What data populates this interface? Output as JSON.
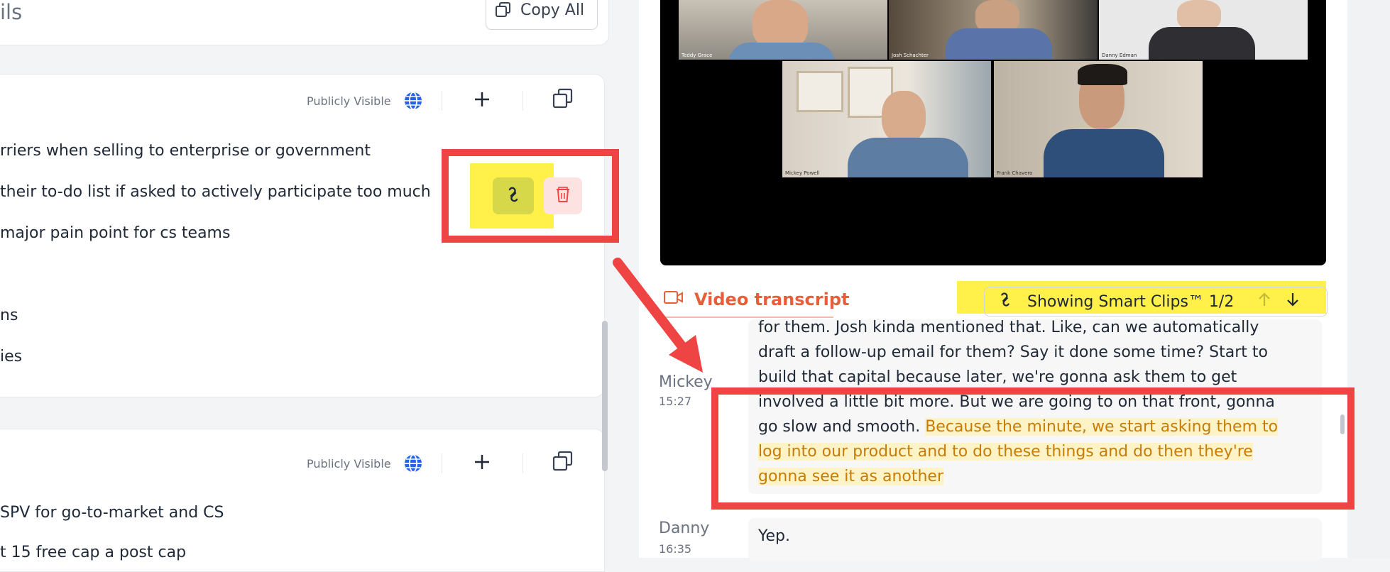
{
  "left": {
    "heading": "ils",
    "copy_all_label": "Copy All",
    "card1": {
      "visibility_label": "Publicly Visible",
      "items": [
        "rriers when selling to enterprise or government",
        "their to-do list if asked to actively participate too much",
        "major pain point for cs teams",
        "ns",
        "ies"
      ]
    },
    "card2": {
      "visibility_label": "Publicly Visible",
      "items": [
        "SPV for go-to-market and CS",
        "t 15 free cap a post cap"
      ]
    }
  },
  "video": {
    "participants": [
      "Teddy Grace",
      "Josh Schachter",
      "Danny Edman",
      "Mickey Powell",
      "Frank Chavero"
    ]
  },
  "transcript": {
    "tab_label": "Video transcript",
    "smart_clips_label": "Showing Smart Clips™ 1/2",
    "entries": [
      {
        "speaker": "Mickey",
        "time": "15:27",
        "lines": [
          "for them. Josh kinda mentioned that. Like, can we automatically",
          "draft a follow-up email for them? Say it done some time? Start to",
          "build that capital because later, we're gonna ask them to get",
          "involved a little bit more. But we are going to on that front, gonna"
        ],
        "line5_plain": "go slow and smooth. ",
        "line5_highlight": "Because the minute, we start asking them to",
        "highlight_lines": [
          "log into our product and to do these things and do then they're",
          "gonna see it as another"
        ]
      },
      {
        "speaker": "Danny",
        "time": "16:35",
        "text": "Yep."
      }
    ]
  },
  "colors": {
    "accent": "#e85d3a",
    "annotation_red": "#ef4444",
    "annotation_yellow": "#fff04a",
    "highlight_text": "#c77c05",
    "globe_blue": "#2563eb"
  }
}
